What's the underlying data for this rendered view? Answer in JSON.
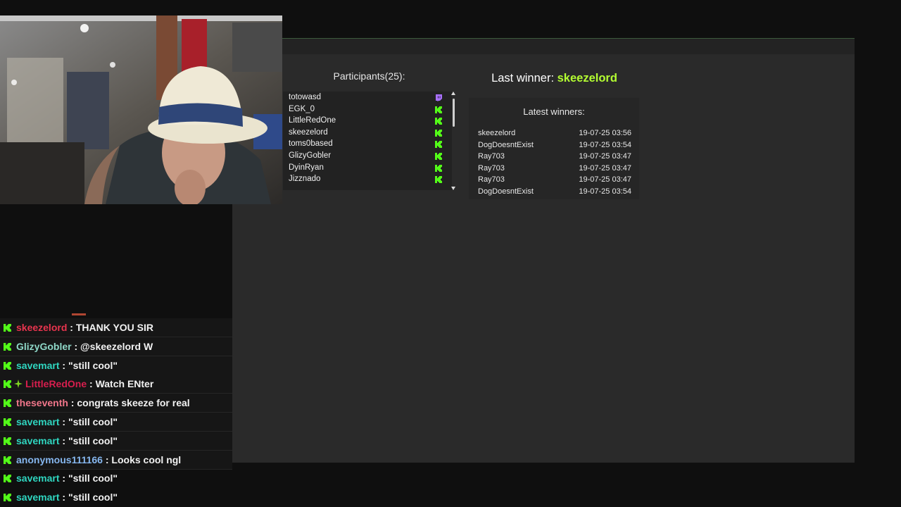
{
  "colors": {
    "accent_green": "#b4ff32",
    "kick_green": "#53fc18",
    "twitch_purple": "#9146ff",
    "panel_bg": "#2a2a2a"
  },
  "participants": {
    "title": "Participants(25):",
    "rows": [
      {
        "name": "totowasd",
        "platform": "twitch-icon"
      },
      {
        "name": "EGK_0",
        "platform": "kick-icon"
      },
      {
        "name": "LittleRedOne",
        "platform": "kick-icon"
      },
      {
        "name": "skeezelord",
        "platform": "kick-icon"
      },
      {
        "name": "toms0based",
        "platform": "kick-icon"
      },
      {
        "name": "GlizyGobler",
        "platform": "kick-icon"
      },
      {
        "name": "DyinRyan",
        "platform": "kick-icon"
      },
      {
        "name": "Jizznado",
        "platform": "kick-icon"
      }
    ]
  },
  "winners": {
    "last_winner_label": "Last winner:",
    "last_winner_name": "skeezelord",
    "latest_title": "Latest winners:",
    "rows": [
      {
        "name": "skeezelord",
        "time": "19-07-25 03:56"
      },
      {
        "name": "DogDoesntExist",
        "time": "19-07-25 03:54"
      },
      {
        "name": "Ray703",
        "time": "19-07-25 03:47"
      },
      {
        "name": "Ray703",
        "time": "19-07-25 03:47"
      },
      {
        "name": "Ray703",
        "time": "19-07-25 03:47"
      },
      {
        "name": "DogDoesntExist",
        "time": "19-07-25 03:54"
      }
    ]
  },
  "chat": {
    "messages": [
      {
        "user": "skeezelord",
        "color": "#e8344e",
        "text": "THANK YOU SIR",
        "extra_badge": false
      },
      {
        "user": "GlizyGobler",
        "color": "#8fd8c8",
        "text": "@skeezelord W",
        "extra_badge": false
      },
      {
        "user": "savemart",
        "color": "#2fd6c0",
        "text": "\"still cool\"",
        "extra_badge": false
      },
      {
        "user": "LittleRedOne",
        "color": "#d81e4e",
        "text": "Watch ENter",
        "extra_badge": true
      },
      {
        "user": "theseventh",
        "color": "#f0768a",
        "text": "congrats skeeze for real",
        "extra_badge": false
      },
      {
        "user": "savemart",
        "color": "#2fd6c0",
        "text": "\"still cool\"",
        "extra_badge": false
      },
      {
        "user": "savemart",
        "color": "#2fd6c0",
        "text": "\"still cool\"",
        "extra_badge": false
      },
      {
        "user": "anonymous111166",
        "color": "#86b7ef",
        "text": "Looks cool ngl",
        "extra_badge": false
      },
      {
        "user": "savemart",
        "color": "#2fd6c0",
        "text": "\"still cool\"",
        "extra_badge": false
      },
      {
        "user": "savemart",
        "color": "#2fd6c0",
        "text": "\"still cool\"",
        "extra_badge": false
      }
    ]
  }
}
